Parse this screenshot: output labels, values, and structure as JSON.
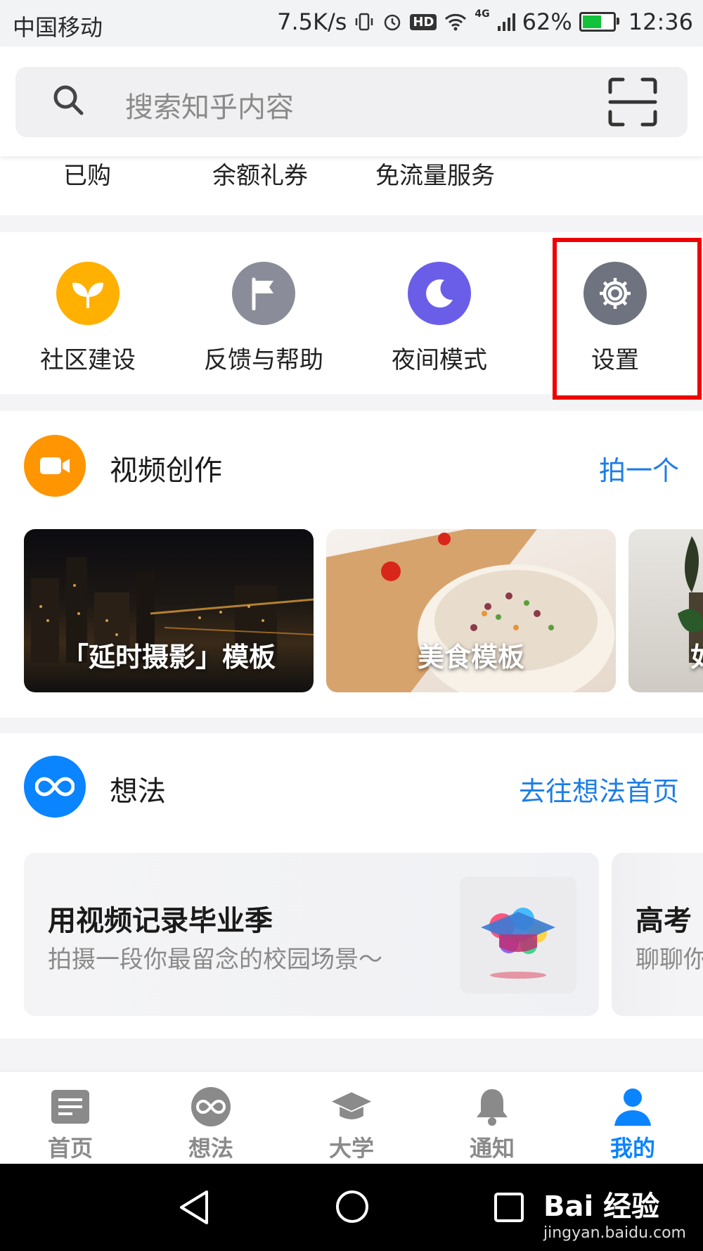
{
  "status_bar": {
    "carrier": "中国移动",
    "speed": "7.5K/s",
    "hd": "HD",
    "network": "4G",
    "battery": "62%",
    "battery_level": 0.62,
    "time": "12:36"
  },
  "search": {
    "placeholder": "搜索知乎内容"
  },
  "wallet": {
    "items": [
      "已购",
      "余额礼券",
      "免流量服务"
    ]
  },
  "tools": {
    "items": [
      {
        "label": "社区建设",
        "icon": "sprout-icon",
        "color": "#ffb000"
      },
      {
        "label": "反馈与帮助",
        "icon": "flag-icon",
        "color": "#8a8d99"
      },
      {
        "label": "夜间模式",
        "icon": "moon-icon",
        "color": "#6a5ee8"
      },
      {
        "label": "设置",
        "icon": "gear-icon",
        "color": "#6f7380"
      }
    ]
  },
  "video": {
    "title": "视频创作",
    "link": "拍一个",
    "icon_color": "#ff9500",
    "templates": [
      "「延时摄影」模板",
      "美食模板",
      "如"
    ]
  },
  "ideas": {
    "title": "想法",
    "link": "去往想法首页",
    "icon_color": "#0a84ff",
    "cards": [
      {
        "title": "用视频记录毕业季",
        "subtitle": "拍摄一段你最留念的校园场景～"
      },
      {
        "title": "高考",
        "subtitle": "聊聊你"
      }
    ]
  },
  "tabbar": {
    "active_color": "#0a84ff",
    "items": [
      {
        "label": "首页",
        "icon": "home-feed-icon"
      },
      {
        "label": "想法",
        "icon": "ideas-icon"
      },
      {
        "label": "大学",
        "icon": "graduation-cap-icon"
      },
      {
        "label": "通知",
        "icon": "bell-icon"
      },
      {
        "label": "我的",
        "icon": "person-icon",
        "active": true
      }
    ]
  },
  "watermark": {
    "brand": "Bai 经验",
    "url": "jingyan.baidu.com"
  }
}
